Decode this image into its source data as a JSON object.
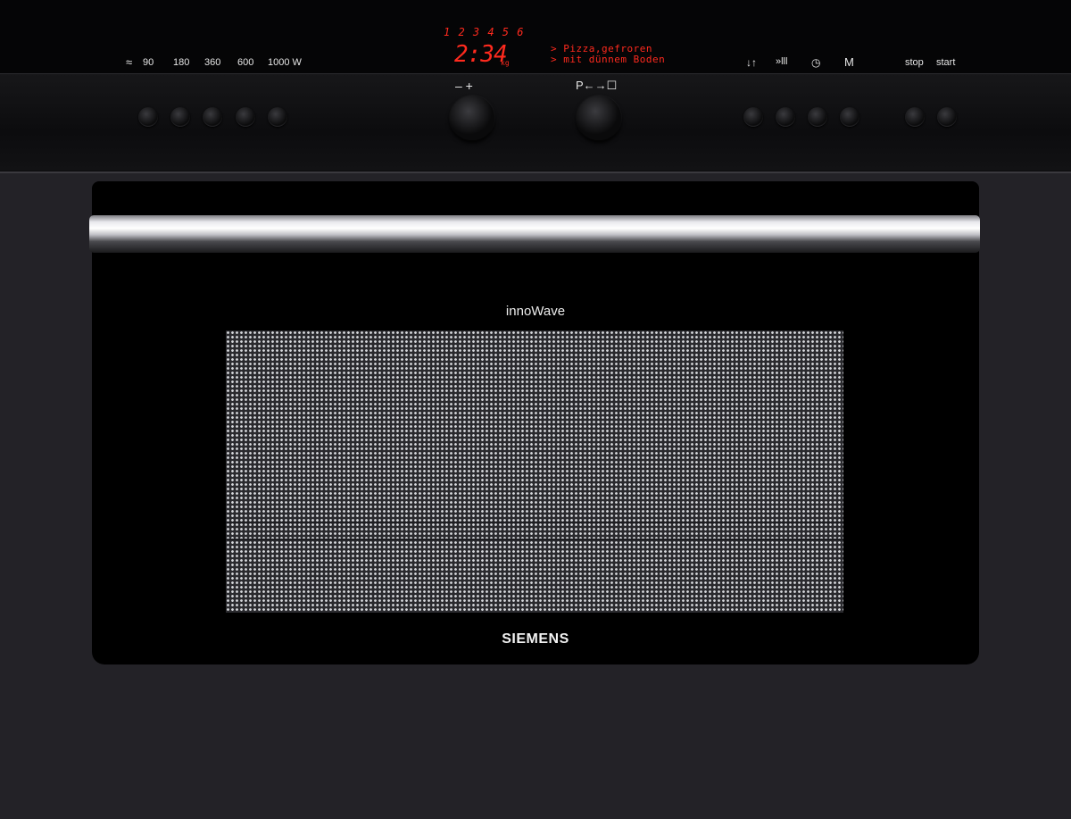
{
  "panel": {
    "power_icon": "wave-icon",
    "power_labels": [
      "90",
      "180",
      "360",
      "600",
      "1000 W"
    ],
    "display": {
      "programs": "1 2 3 4 5 6",
      "time": "2:34",
      "unit": "kg",
      "message_line1": "> Pizza,gefroren",
      "message_line2": "> mit dünnem Boden"
    },
    "knob_left_label": "–  +",
    "knob_right_label": "P←→☐",
    "function_labels": [
      "↓↑",
      "»lll",
      "◷",
      "M"
    ],
    "stop_label": "stop",
    "start_label": "start"
  },
  "door": {
    "model_label": "innoWave",
    "brand": "SIEMENS"
  },
  "colors": {
    "display_red": "#ff2a1e",
    "body": "#232227"
  }
}
